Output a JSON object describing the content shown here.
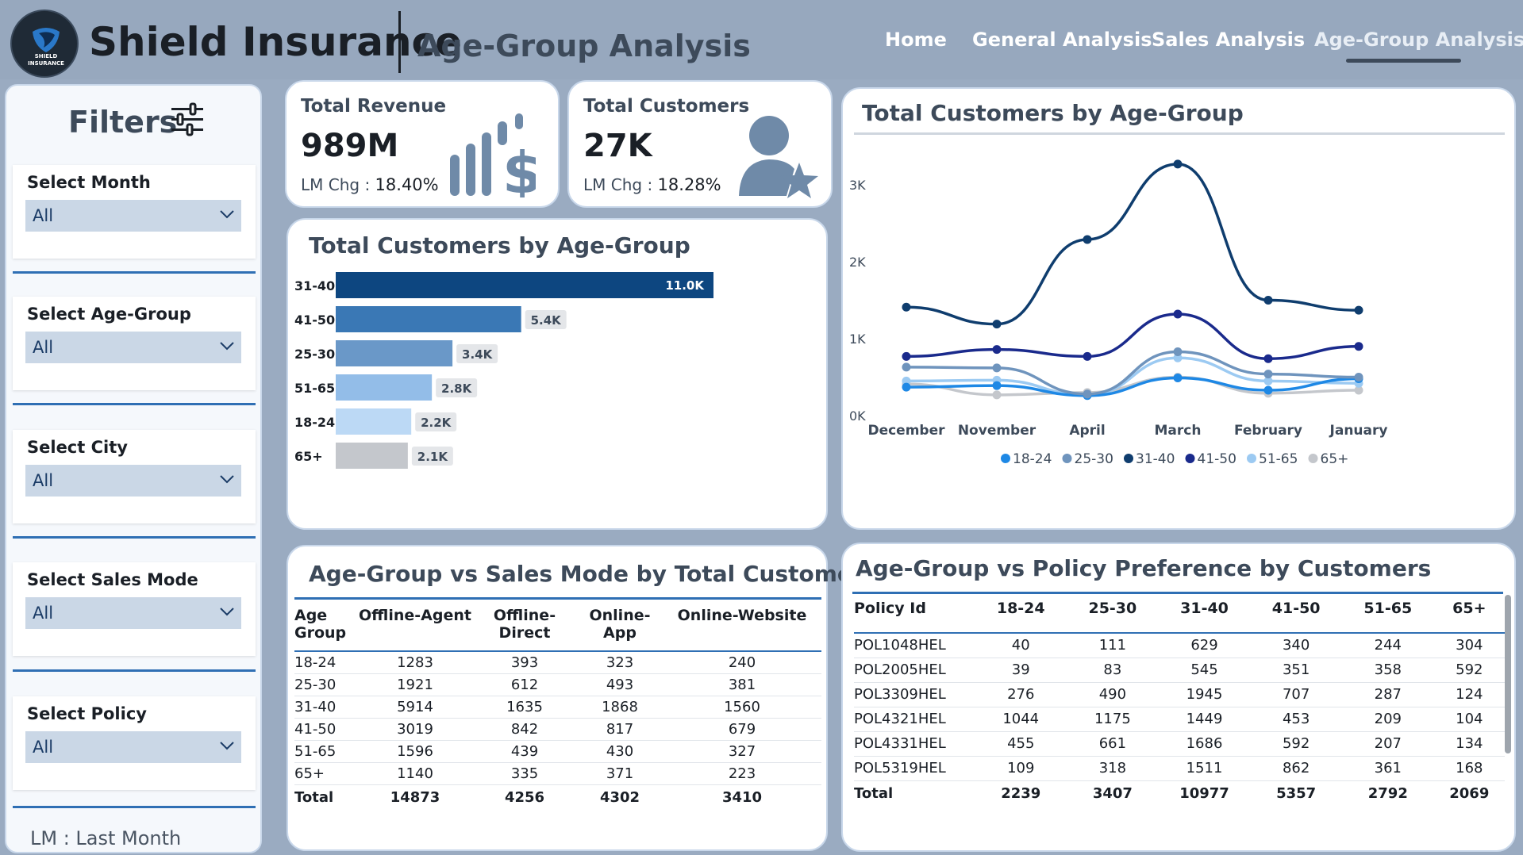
{
  "header": {
    "logo_text_1": "SHIELD",
    "logo_text_2": "INSURANCE",
    "brand": "Shield Insurance",
    "page_title": "Age-Group Analysis",
    "nav": [
      "Home",
      "General Analysis",
      "Sales Analysis",
      "Age-Group Analysis"
    ],
    "active_nav": "Age-Group Analysis"
  },
  "filters": {
    "title": "Filters",
    "slicers": [
      {
        "label": "Select Month",
        "value": "All"
      },
      {
        "label": "Select Age-Group",
        "value": "All"
      },
      {
        "label": "Select City",
        "value": "All"
      },
      {
        "label": "Select Sales Mode",
        "value": "All"
      },
      {
        "label": "Select Policy",
        "value": "All"
      }
    ],
    "note": "LM : Last Month"
  },
  "kpis": {
    "revenue": {
      "title": "Total Revenue",
      "value": "989M",
      "chg_label": "LM Chg :",
      "chg_value": "18.40%"
    },
    "customers": {
      "title": "Total Customers",
      "value": "27K",
      "chg_label": "LM Chg :",
      "chg_value": "18.28%"
    }
  },
  "colors": {
    "18-24": "#1e88e5",
    "25-30": "#6f94bd",
    "31-40": "#0f3d6e",
    "41-50": "#1a2a8c",
    "51-65": "#9ccaf2",
    "65+": "#c4c7cc",
    "bar_31_40": "#0d4680",
    "bar_41_50": "#3a78b5",
    "bar_25_30": "#6a98c8",
    "bar_51_65": "#93bde8",
    "bar_18_24": "#bcd9f5",
    "bar_65": "#c4c7cc"
  },
  "chart_data": [
    {
      "type": "bar",
      "orientation": "horizontal",
      "title": "Total Customers by Age-Group",
      "categories": [
        "31-40",
        "41-50",
        "25-30",
        "51-65",
        "18-24",
        "65+"
      ],
      "values": [
        11000,
        5400,
        3400,
        2800,
        2200,
        2100
      ],
      "data_labels": [
        "11.0K",
        "5.4K",
        "3.4K",
        "2.8K",
        "2.2K",
        "2.1K"
      ]
    },
    {
      "type": "line",
      "title": "Total Customers by Age-Group",
      "x": [
        "December",
        "November",
        "April",
        "March",
        "February",
        "January"
      ],
      "ylim": [
        0,
        3300
      ],
      "yticks": [
        0,
        1000,
        2000,
        3000
      ],
      "ytick_labels": [
        "0K",
        "1K",
        "2K",
        "3K"
      ],
      "grid": false,
      "legend": "bottom",
      "series": [
        {
          "name": "18-24",
          "values": [
            370,
            390,
            260,
            490,
            330,
            480
          ]
        },
        {
          "name": "25-30",
          "values": [
            630,
            620,
            280,
            830,
            540,
            500
          ]
        },
        {
          "name": "31-40",
          "values": [
            1410,
            1190,
            2290,
            3270,
            1500,
            1370
          ]
        },
        {
          "name": "41-50",
          "values": [
            770,
            860,
            770,
            1320,
            740,
            900
          ]
        },
        {
          "name": "51-65",
          "values": [
            450,
            460,
            270,
            750,
            450,
            420
          ]
        },
        {
          "name": "65+",
          "values": [
            410,
            270,
            300,
            500,
            290,
            330
          ]
        }
      ]
    }
  ],
  "sales_table": {
    "title": "Age-Group vs Sales Mode by Total Customers",
    "headers": [
      "Age Group",
      "Offline-Agent",
      "Offline-Direct",
      "Online-App",
      "Online-Website"
    ],
    "rows": [
      [
        "18-24",
        "1283",
        "393",
        "323",
        "240"
      ],
      [
        "25-30",
        "1921",
        "612",
        "493",
        "381"
      ],
      [
        "31-40",
        "5914",
        "1635",
        "1868",
        "1560"
      ],
      [
        "41-50",
        "3019",
        "842",
        "817",
        "679"
      ],
      [
        "51-65",
        "1596",
        "439",
        "430",
        "327"
      ],
      [
        "65+",
        "1140",
        "335",
        "371",
        "223"
      ]
    ],
    "total": [
      "Total",
      "14873",
      "4256",
      "4302",
      "3410"
    ]
  },
  "policy_table": {
    "title": "Age-Group vs Policy Preference by Customers",
    "headers": [
      "Policy Id",
      "18-24",
      "25-30",
      "31-40",
      "41-50",
      "51-65",
      "65+"
    ],
    "rows": [
      [
        "POL1048HEL",
        "40",
        "111",
        "629",
        "340",
        "244",
        "304"
      ],
      [
        "POL2005HEL",
        "39",
        "83",
        "545",
        "351",
        "358",
        "592"
      ],
      [
        "POL3309HEL",
        "276",
        "490",
        "1945",
        "707",
        "287",
        "124"
      ],
      [
        "POL4321HEL",
        "1044",
        "1175",
        "1449",
        "453",
        "209",
        "104"
      ],
      [
        "POL4331HEL",
        "455",
        "661",
        "1686",
        "592",
        "207",
        "134"
      ],
      [
        "POL5319HEL",
        "109",
        "318",
        "1511",
        "862",
        "361",
        "168"
      ]
    ],
    "total": [
      "Total",
      "2239",
      "3407",
      "10977",
      "5357",
      "2792",
      "2069"
    ]
  }
}
